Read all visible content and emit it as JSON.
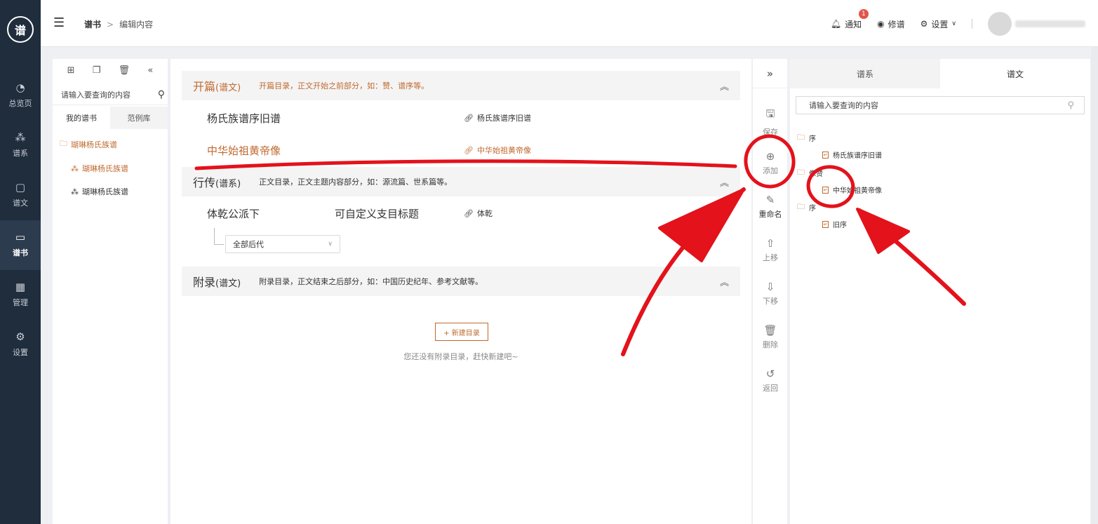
{
  "sidenav": {
    "logo_text": "谱",
    "items": [
      {
        "label": "总览页",
        "icon": "pie-chart-icon",
        "glyph": "◔"
      },
      {
        "label": "谱系",
        "icon": "tree-icon",
        "glyph": "⁂"
      },
      {
        "label": "谱文",
        "icon": "document-icon",
        "glyph": "▢"
      },
      {
        "label": "谱书",
        "icon": "book-icon",
        "glyph": "▭"
      },
      {
        "label": "管理",
        "icon": "grid-icon",
        "glyph": "▦"
      },
      {
        "label": "设置",
        "icon": "gear-icon",
        "glyph": "⚙"
      }
    ]
  },
  "header": {
    "crumb1": "谱书",
    "crumb_sep": ">",
    "crumb2": "编辑内容",
    "notify_label": "通知",
    "notify_count": "1",
    "edit_label": "修谱",
    "settings_label": "设置"
  },
  "panel1": {
    "search_placeholder": "请输入要查询的内容",
    "tab_mine": "我的谱书",
    "tab_examples": "范例库",
    "root": "瑚琳杨氏族谱",
    "leaf1": "瑚琳杨氏族谱",
    "leaf2": "瑚琳杨氏族谱"
  },
  "center": {
    "sec1_title": "开篇",
    "sec1_sub": "(谱文)",
    "sec1_desc": "开篇目录，正文开始之前部分，如：赞、谱序等。",
    "row1": "杨氏族谱序旧谱",
    "row1_link": "杨氏族谱序旧谱",
    "row2": "中华始祖黄帝像",
    "row2_link": "中华始祖黄帝像",
    "sec2_title": "行传",
    "sec2_sub": "(谱系)",
    "sec2_desc": "正文目录，正文主题内容部分，如：源流篇、世系篇等。",
    "row3": "体乾公派下",
    "row3_mid": "可自定义支目标题",
    "row3_link": "体乾",
    "select_value": "全部后代",
    "sec3_title": "附录",
    "sec3_sub": "(谱文)",
    "sec3_desc": "附录目录，正文结束之后部分，如：中国历史纪年、参考文献等。",
    "new_btn": "+ 新建目录",
    "empty_note": "您还没有附录目录，赶快新建吧~"
  },
  "toolbar": {
    "save": "保存",
    "add": "添加",
    "rename": "重命名",
    "up": "上移",
    "down": "下移",
    "delete": "删除",
    "back": "返回"
  },
  "rpanel": {
    "tab_lineage": "谱系",
    "tab_text": "谱文",
    "search_placeholder": "请输入要查询的内容",
    "folder1": "序",
    "doc1": "杨氏族谱序旧谱",
    "folder2": "像赞",
    "doc2": "中华始祖黄帝像",
    "folder3": "序",
    "doc3": "旧序"
  },
  "colors": {
    "accent": "#c0692e",
    "sidebar": "#1f2d3d",
    "annotation": "#e3121b"
  }
}
